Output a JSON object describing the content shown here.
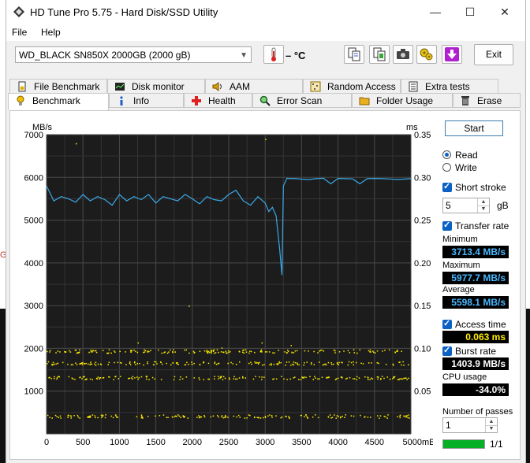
{
  "window": {
    "title": "HD Tune Pro 5.75 - Hard Disk/SSD Utility",
    "minimize": "—",
    "maximize": "☐",
    "close": "✕"
  },
  "menu": [
    {
      "label": "File"
    },
    {
      "label": "Help"
    }
  ],
  "toolbar": {
    "drive": "WD_BLACK SN850X 2000GB (2000 gB)",
    "temperature": "– °C",
    "exit_label": "Exit"
  },
  "tabs_top": [
    {
      "label": "File Benchmark",
      "icon": "file-benchmark-icon"
    },
    {
      "label": "Disk monitor",
      "icon": "disk-monitor-icon"
    },
    {
      "label": "AAM",
      "icon": "speaker-icon"
    },
    {
      "label": "Random Access",
      "icon": "random-access-icon"
    },
    {
      "label": "Extra tests",
      "icon": "extra-tests-icon"
    }
  ],
  "tabs_bottom": [
    {
      "label": "Benchmark",
      "icon": "benchmark-icon",
      "active": true
    },
    {
      "label": "Info",
      "icon": "info-icon"
    },
    {
      "label": "Health",
      "icon": "health-cross-icon"
    },
    {
      "label": "Error Scan",
      "icon": "magnifier-icon"
    },
    {
      "label": "Folder Usage",
      "icon": "folder-icon"
    },
    {
      "label": "Erase",
      "icon": "trash-icon"
    }
  ],
  "side": {
    "start_label": "Start",
    "read_label": "Read",
    "write_label": "Write",
    "short_stroke_label": "Short stroke",
    "short_stroke_value": "5",
    "short_stroke_unit": "gB",
    "transfer_rate_label": "Transfer rate",
    "minimum_label": "Minimum",
    "minimum_value": "3713.4 MB/s",
    "maximum_label": "Maximum",
    "maximum_value": "5977.7 MB/s",
    "average_label": "Average",
    "average_value": "5598.1 MB/s",
    "access_time_label": "Access time",
    "access_time_value": "0.063 ms",
    "burst_rate_label": "Burst rate",
    "burst_rate_value": "1403.9 MB/s",
    "cpu_usage_label": "CPU usage",
    "cpu_usage_value": "-34.0%",
    "passes_label": "Number of passes",
    "passes_value": "1",
    "pass_progress_text": "1/1",
    "pass_progress": 1.0
  },
  "chart_data": {
    "type": "line",
    "ylabel_left": "MB/s",
    "ylabel_right": "ms",
    "xunit": "mB",
    "x_ticks": [
      0,
      500,
      1000,
      1500,
      2000,
      2500,
      3000,
      3500,
      4000,
      4500,
      5000
    ],
    "y_left_ticks": [
      1000,
      2000,
      3000,
      4000,
      5000,
      6000,
      7000
    ],
    "y_right_ticks": [
      "0.05",
      "0.10",
      "0.15",
      "0.20",
      "0.25",
      "0.30",
      "0.35"
    ],
    "xlim": [
      0,
      5000
    ],
    "ylim_left": [
      0,
      7000
    ],
    "ylim_right": [
      0,
      0.35
    ],
    "grid": true,
    "series": [
      {
        "kind": "line",
        "color": "#3aa8e8",
        "x": [
          0,
          100,
          200,
          300,
          400,
          500,
          600,
          700,
          800,
          900,
          1000,
          1100,
          1200,
          1300,
          1400,
          1500,
          1600,
          1700,
          1800,
          1900,
          2000,
          2100,
          2200,
          2300,
          2400,
          2500,
          2600,
          2700,
          2800,
          2900,
          3000,
          3050,
          3100,
          3150,
          3200,
          3230,
          3250,
          3300,
          3350,
          3400,
          3500,
          3600,
          3700,
          3800,
          3900,
          4000,
          4100,
          4200,
          4300,
          4400,
          4500,
          4600,
          4700,
          4800,
          4900,
          5000
        ],
        "y": [
          5800,
          5450,
          5550,
          5500,
          5420,
          5600,
          5450,
          5550,
          5480,
          5350,
          5600,
          5450,
          5550,
          5480,
          5600,
          5400,
          5550,
          5500,
          5450,
          5600,
          5500,
          5380,
          5550,
          5480,
          5450,
          5600,
          5700,
          5450,
          5350,
          5550,
          5400,
          5200,
          5300,
          5100,
          4300,
          3713,
          5800,
          5980,
          5970,
          5975,
          5960,
          5950,
          5970,
          5980,
          5850,
          5975,
          5970,
          5965,
          5850,
          5970,
          5975,
          5970,
          5965,
          5950,
          5960,
          5970
        ]
      },
      {
        "kind": "scatter",
        "color": "#ffee00",
        "bands_ms": [
          0.097,
          0.083,
          0.066,
          0.021
        ],
        "x_range": [
          0,
          5000
        ]
      }
    ]
  }
}
